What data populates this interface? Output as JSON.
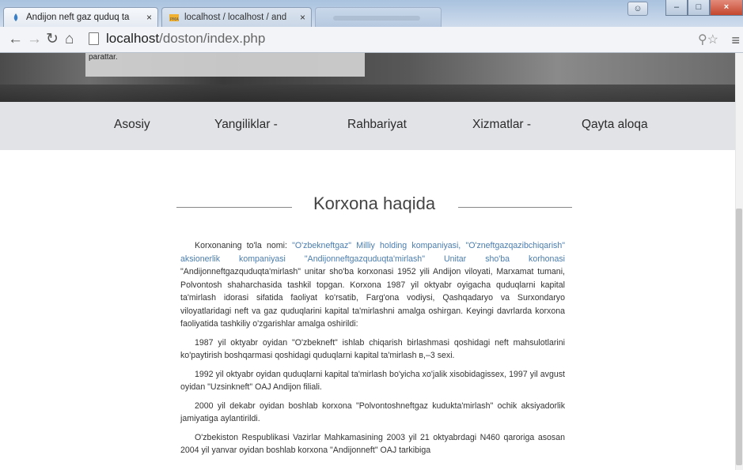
{
  "browser": {
    "tabs": [
      {
        "label": "Andijon neft gaz quduq ta",
        "close": "×",
        "active": true
      },
      {
        "label": "localhost / localhost / and",
        "close": "×",
        "active": false
      },
      {
        "label": "",
        "close": "",
        "active": false
      }
    ],
    "url_host": "localhost",
    "url_path": "/doston/index.php",
    "window_buttons": {
      "minimize": "–",
      "maximize": "□",
      "close": "×"
    },
    "colors": {
      "tab_bar": "#cfdced",
      "toolbar": "#f2f4f7"
    }
  },
  "banner": {
    "caption": "parattar."
  },
  "nav": {
    "items": [
      "Asosiy",
      "Yangiliklar -",
      "Rahbariyat",
      "Xizmatlar -",
      "Qayta aloqa"
    ]
  },
  "section": {
    "title": "Korxona haqida"
  },
  "article": {
    "p1_lead": "Korxonaning to'la nomi: ",
    "p1_link": "\"O'zbekneftgaz\" Milliy holding kompaniyasi, \"O'zneftgazqazibchiqarish\" aksionerlik kompaniyasi \"Andijonneftgazquduqta'mirlash\" Unitar sho'ba korhonasi",
    "p1_rest": " \"Andijonneftgazquduqta'mirlash\" unitar sho'ba korxonasi 1952 yili Andijon viloyati, Marxamat tumani, Polvontosh shaharchasida tashkil topgan. Korxona 1987 yil oktyabr oyigacha quduqlarni kapital ta'mirlash idorasi sifatida faoliyat ko'rsatib, Farg'ona vodiysi, Qashqadaryo va Surxondaryo viloyatlaridagi neft va gaz quduqlarini kapital ta'mirlashni amalga oshirgan. Keyingi davrlarda korxona faoliyatida tashkiliy o'zgarishlar amalga oshirildi:",
    "p2": "1987 yil oktyabr oyidan \"O'zbekneft\" ishlab chiqarish birlashmasi qoshidagi neft mahsulotlarini ko'paytirish boshqarmasi qoshidagi quduqlarni kapital ta'mirlash в,–3 sexi.",
    "p3": "1992 yil oktyabr oyidan quduqlarni kapital ta'mirlash bo'yicha xo'jalik xisobidagissex, 1997 yil avgust oyidan \"Uzsinkneft\" OAJ Andijon filiali.",
    "p4": "2000 yil dekabr oyidan boshlab korxona \"Polvontoshneftgaz kudukta'mirlash\" ochik aksiyadorlik jamiyatiga aylantirildi.",
    "p5": "O'zbekiston Respublikasi Vazirlar Mahkamasining 2003 yil 21 oktyabrdagi N460 qaroriga asosan 2004 yil yanvar oyidan boshlab korxona \"Andijonneft\" OAJ tarkibiga"
  }
}
